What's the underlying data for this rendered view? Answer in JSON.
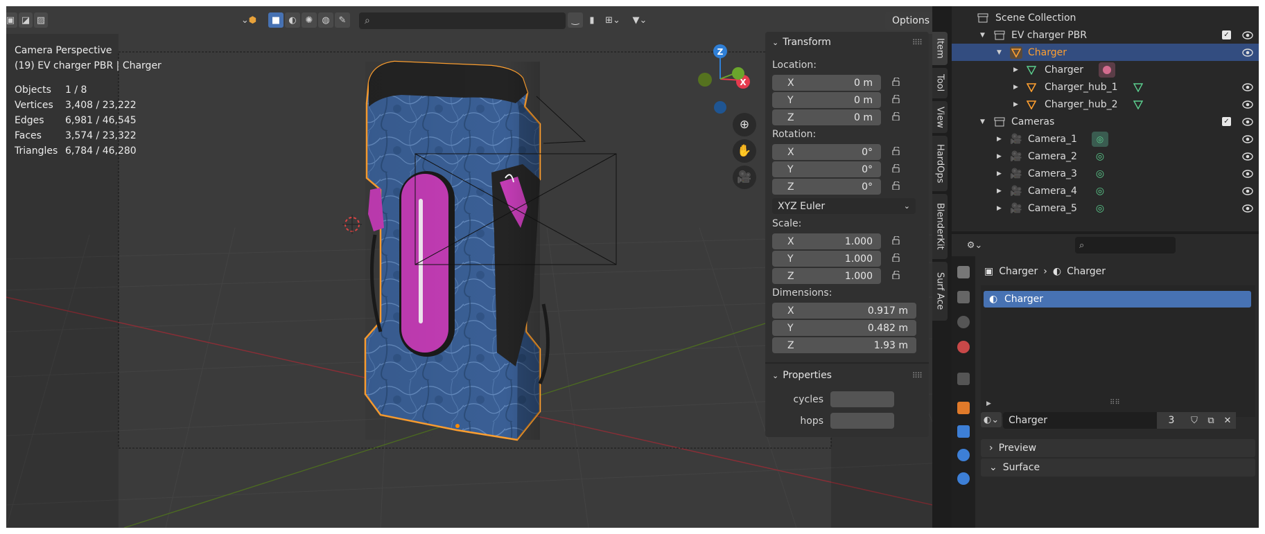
{
  "viewport": {
    "view_name": "Camera Perspective",
    "object_context": "(19) EV charger PBR | Charger",
    "stats": [
      {
        "label": "Objects",
        "value": "1 / 8"
      },
      {
        "label": "Vertices",
        "value": "3,408 / 23,222"
      },
      {
        "label": "Edges",
        "value": "6,981 / 46,545"
      },
      {
        "label": "Faces",
        "value": "3,574 / 23,322"
      },
      {
        "label": "Triangles",
        "value": "6,784 / 46,280"
      }
    ],
    "options_label": "Options",
    "gizmo": {
      "z": "Z",
      "x": "X"
    }
  },
  "npanel": {
    "transform_title": "Transform",
    "location_label": "Location:",
    "location": [
      {
        "axis": "X",
        "value": "0 m"
      },
      {
        "axis": "Y",
        "value": "0 m"
      },
      {
        "axis": "Z",
        "value": "0 m"
      }
    ],
    "rotation_label": "Rotation:",
    "rotation": [
      {
        "axis": "X",
        "value": "0°"
      },
      {
        "axis": "Y",
        "value": "0°"
      },
      {
        "axis": "Z",
        "value": "0°"
      }
    ],
    "rotation_mode": "XYZ Euler",
    "scale_label": "Scale:",
    "scale": [
      {
        "axis": "X",
        "value": "1.000"
      },
      {
        "axis": "Y",
        "value": "1.000"
      },
      {
        "axis": "Z",
        "value": "1.000"
      }
    ],
    "dimensions_label": "Dimensions:",
    "dimensions": [
      {
        "axis": "X",
        "value": "0.917 m"
      },
      {
        "axis": "Y",
        "value": "0.482 m"
      },
      {
        "axis": "Z",
        "value": "1.93 m"
      }
    ],
    "properties_title": "Properties",
    "props": [
      {
        "label": "cycles"
      },
      {
        "label": "hops"
      }
    ]
  },
  "tabs": [
    "Item",
    "Tool",
    "View",
    "HardOps",
    "BlenderKit",
    "Surf Ace"
  ],
  "outliner": {
    "scene_collection": "Scene Collection",
    "collection1": "EV charger PBR",
    "charger_obj": "Charger",
    "charger_mesh": "Charger",
    "hub1": "Charger_hub_1",
    "hub2": "Charger_hub_2",
    "collection2": "Cameras",
    "cameras": [
      "Camera_1",
      "Camera_2",
      "Camera_3",
      "Camera_4",
      "Camera_5"
    ]
  },
  "properties": {
    "crumb_object": "Charger",
    "crumb_material": "Charger",
    "slot_name": "Charger",
    "material_name": "Charger",
    "user_count": "3",
    "preview_label": "Preview",
    "surface_label": "Surface"
  },
  "colors": {
    "accent_blue": "#4772b3",
    "selection_orange": "#ffa030",
    "magenta": "#c23cb4",
    "axis_x_red": "#e63b4e",
    "axis_z_blue": "#2f7fd6",
    "axis_y_green": "#6ba52c"
  }
}
